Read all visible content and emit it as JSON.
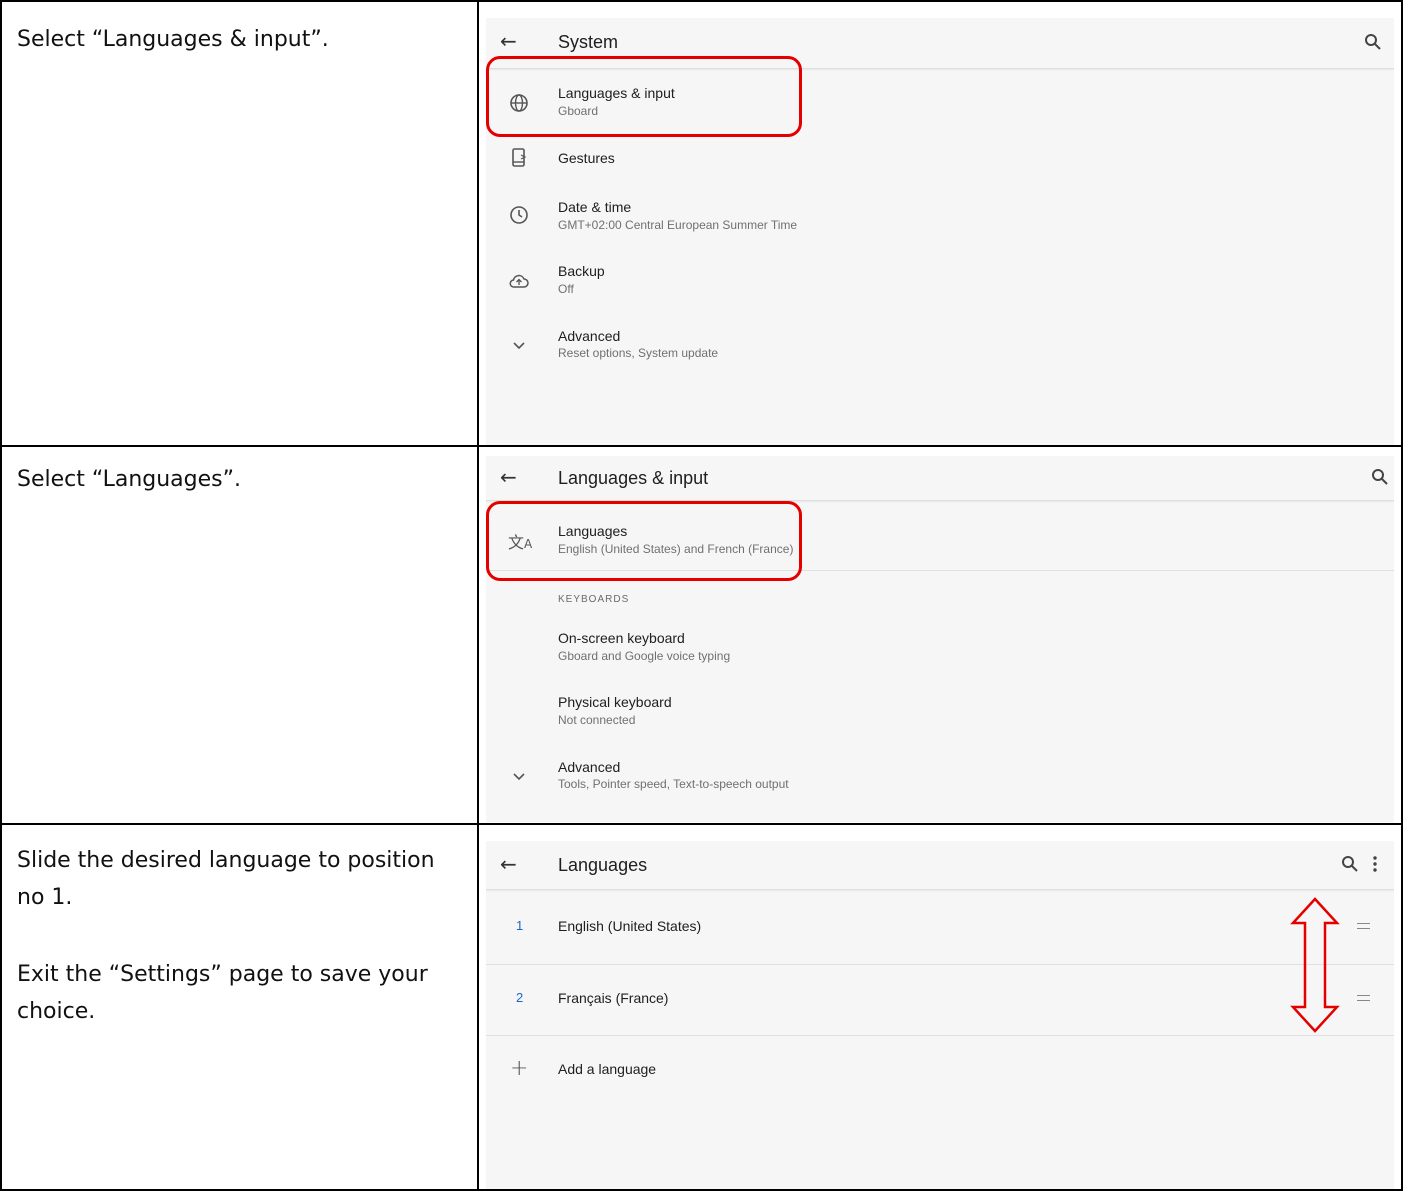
{
  "instructions": {
    "row1": "Select “Languages & input”.",
    "row2": "Select “Languages”.",
    "row3_line1": "Slide the desired language to position no 1.",
    "row3_line2": "Exit the “Settings” page to save your choice."
  },
  "screen1": {
    "title": "System",
    "items": [
      {
        "label": "Languages & input",
        "sub": "Gboard",
        "icon": "globe-icon"
      },
      {
        "label": "Gestures",
        "sub": "",
        "icon": "phone-gesture-icon"
      },
      {
        "label": "Date & time",
        "sub": "GMT+02:00 Central European Summer Time",
        "icon": "clock-icon"
      },
      {
        "label": "Backup",
        "sub": "Off",
        "icon": "cloud-upload-icon"
      },
      {
        "label": "Advanced",
        "sub": "Reset options, System update",
        "icon": "chevron-down-icon"
      }
    ]
  },
  "screen2": {
    "title": "Languages & input",
    "languages_label": "Languages",
    "languages_sub": "English (United States) and French (France)",
    "keyboards_header": "KEYBOARDS",
    "onscreen_label": "On-screen keyboard",
    "onscreen_sub": "Gboard and Google voice typing",
    "physical_label": "Physical keyboard",
    "physical_sub": "Not connected",
    "advanced_label": "Advanced",
    "advanced_sub": "Tools, Pointer speed, Text-to-speech output"
  },
  "screen3": {
    "title": "Languages",
    "languages": [
      {
        "num": "1",
        "name": "English (United States)"
      },
      {
        "num": "2",
        "name": "Français (France)"
      }
    ],
    "add_label": "Add a language",
    "add_symbol": "+"
  },
  "colors": {
    "highlight": "#e50000",
    "accent": "#1a66c8"
  }
}
